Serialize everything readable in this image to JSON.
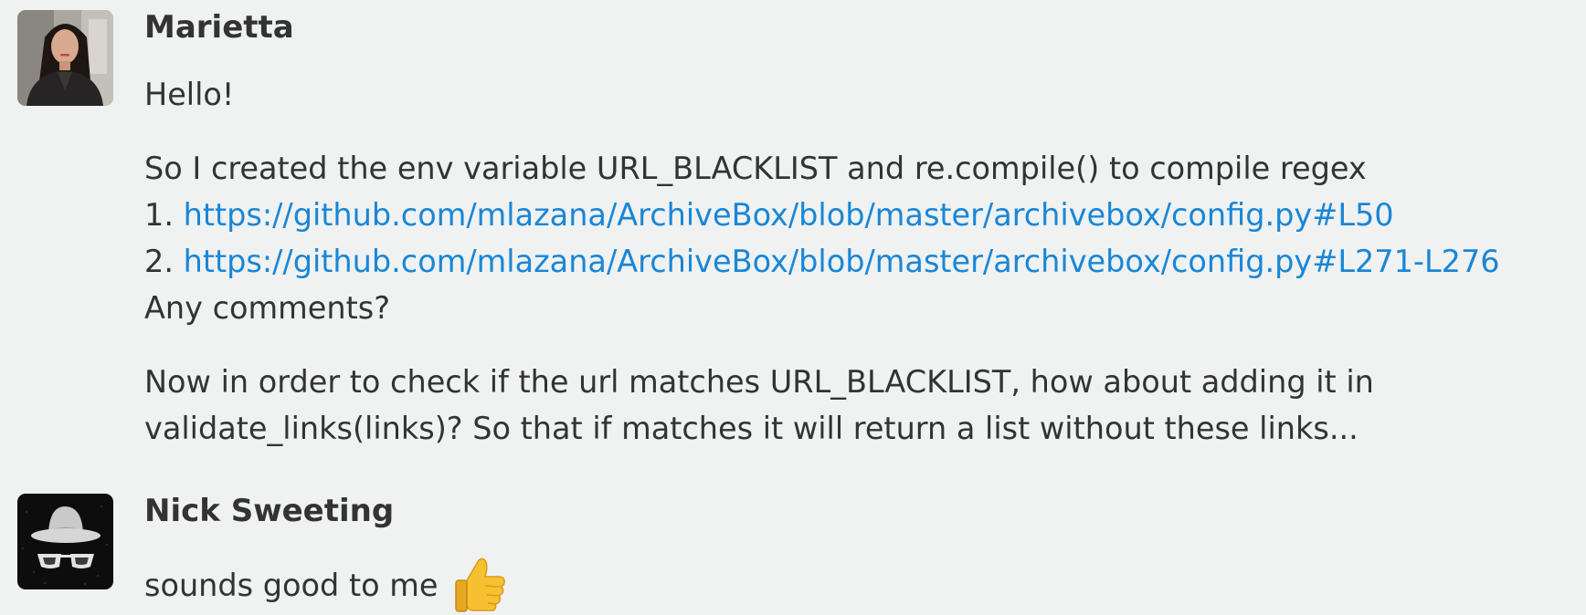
{
  "messages": [
    {
      "author": "Marietta",
      "avatar_icon": "user-photo-avatar",
      "paragraphs": [
        "Hello!",
        "So I created the env variable URL_BLACKLIST and re.compile() to compile regex"
      ],
      "list": [
        {
          "prefix": "1. ",
          "url": "https://github.com/mlazana/ArchiveBox/blob/master/archivebox/config.py#L50"
        },
        {
          "prefix": "2. ",
          "url": "https://github.com/mlazana/ArchiveBox/blob/master/archivebox/config.py#L271-L276"
        }
      ],
      "after_list": "Any comments?",
      "closing_lines": [
        "Now in order to check if the url matches URL_BLACKLIST, how about adding it in",
        "validate_links(links)? So that if matches it will return a list without these links..."
      ]
    },
    {
      "author": "Nick Sweeting",
      "avatar_icon": "hat-and-sunglasses-avatar",
      "text": "sounds good to me",
      "emoji": "thumbs-up-icon"
    }
  ],
  "colors": {
    "background": "#eff2f1",
    "text": "#333333",
    "link": "#1a86d6",
    "thumb": "#f7c030"
  }
}
